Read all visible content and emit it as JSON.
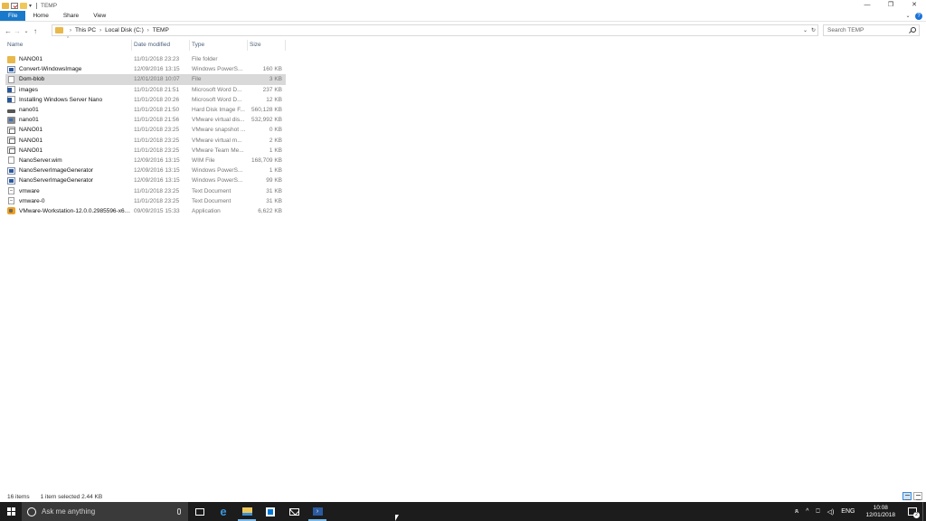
{
  "window": {
    "title": "TEMP"
  },
  "ribbon": {
    "tabs": [
      "File",
      "Home",
      "Share",
      "View"
    ]
  },
  "address": {
    "crumbs": [
      "This PC",
      "Local Disk (C:)",
      "TEMP"
    ],
    "search_placeholder": "Search TEMP"
  },
  "columns": {
    "name": "Name",
    "date": "Date modified",
    "type": "Type",
    "size": "Size"
  },
  "files": [
    {
      "name": "NANO01",
      "date": "11/01/2018 23:23",
      "type": "File folder",
      "size": "",
      "icon": "folder-icon"
    },
    {
      "name": "Convert-WindowsImage",
      "date": "12/09/2016 13:15",
      "type": "Windows PowerS...",
      "size": "160 KB",
      "icon": "powershell-file-icon"
    },
    {
      "name": "Dom-blob",
      "date": "12/01/2018 10:07",
      "type": "File",
      "size": "3 KB",
      "icon": "file-icon",
      "selected": true
    },
    {
      "name": "images",
      "date": "11/01/2018 21:51",
      "type": "Microsoft Word D...",
      "size": "237 KB",
      "icon": "word-document-icon"
    },
    {
      "name": "Installing Windows Server Nano",
      "date": "11/01/2018 20:26",
      "type": "Microsoft Word D...",
      "size": "12 KB",
      "icon": "word-document-icon"
    },
    {
      "name": "nano01",
      "date": "11/01/2018 21:50",
      "type": "Hard Disk Image F...",
      "size": "560,128 KB",
      "icon": "disk-image-icon"
    },
    {
      "name": "nano01",
      "date": "11/01/2018 21:56",
      "type": "VMware virtual dis...",
      "size": "532,992 KB",
      "icon": "vmware-disk-icon"
    },
    {
      "name": "NANO01",
      "date": "11/01/2018 23:25",
      "type": "VMware snapshot ...",
      "size": "0 KB",
      "icon": "vmware-file-icon"
    },
    {
      "name": "NANO01",
      "date": "11/01/2018 23:25",
      "type": "VMware virtual m...",
      "size": "2 KB",
      "icon": "vmware-file-icon"
    },
    {
      "name": "NANO01",
      "date": "11/01/2018 23:25",
      "type": "VMware Team Me...",
      "size": "1 KB",
      "icon": "vmware-file-icon"
    },
    {
      "name": "NanoServer.wim",
      "date": "12/09/2016 13:15",
      "type": "WIM File",
      "size": "168,709 KB",
      "icon": "file-icon"
    },
    {
      "name": "NanoServerImageGenerator",
      "date": "12/09/2016 13:15",
      "type": "Windows PowerS...",
      "size": "1 KB",
      "icon": "powershell-file-icon"
    },
    {
      "name": "NanoServerImageGenerator",
      "date": "12/09/2016 13:15",
      "type": "Windows PowerS...",
      "size": "99 KB",
      "icon": "powershell-file-icon"
    },
    {
      "name": "vmware",
      "date": "11/01/2018 23:25",
      "type": "Text Document",
      "size": "31 KB",
      "icon": "text-document-icon"
    },
    {
      "name": "vmware-0",
      "date": "11/01/2018 23:25",
      "type": "Text Document",
      "size": "31 KB",
      "icon": "text-document-icon"
    },
    {
      "name": "VMware-Workstation-12.0.0.2985596-x64...",
      "date": "09/09/2015 15:33",
      "type": "Application",
      "size": "6,622 KB",
      "icon": "application-icon"
    }
  ],
  "status": {
    "items": "16 items",
    "selection": "1 item selected  2.44 KB"
  },
  "taskbar": {
    "search_text": "Ask me anything",
    "language": "ENG",
    "time": "10:08",
    "date": "12/01/2018",
    "notification_count": "2"
  }
}
